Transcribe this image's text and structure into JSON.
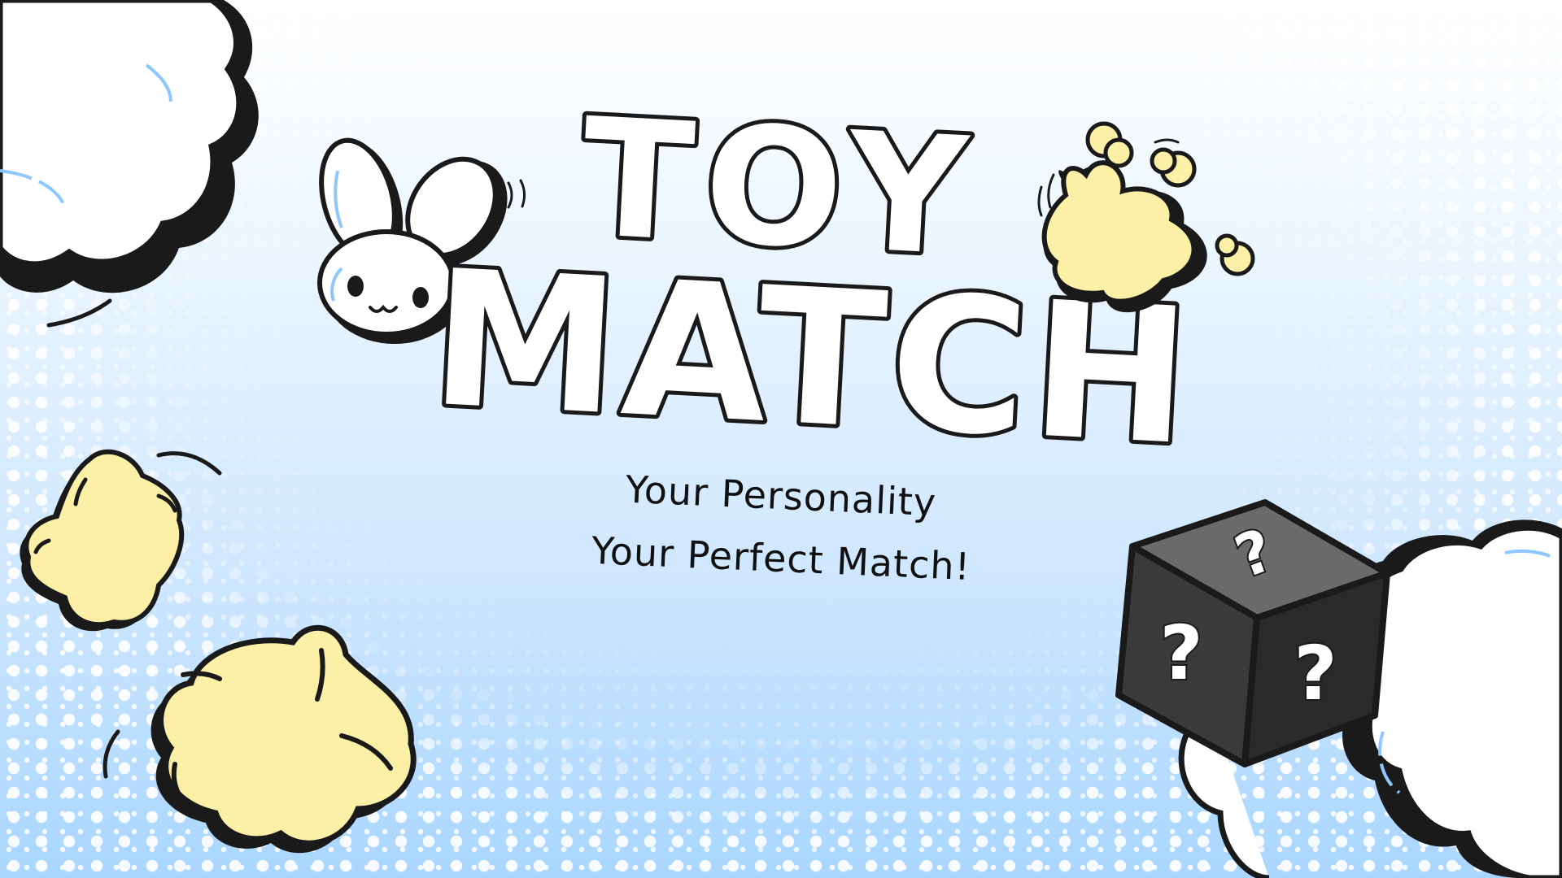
{
  "logo": {
    "line1": "TOY",
    "line2": "MATCH"
  },
  "tagline": {
    "line1": "Your Personality",
    "line2": "Your Perfect Match!"
  },
  "mystery_box_marks": [
    "?",
    "?",
    "?"
  ],
  "colors": {
    "background_top": "#ffffff",
    "background_bottom": "#a9d6ff",
    "outline": "#1a1a1a",
    "star_yellow": "#fbf0a6",
    "cloud_white": "#ffffff",
    "accent_blue": "#8cc8ff",
    "box_dark": "#3a3a3a"
  },
  "decorations": [
    "cloud-icon",
    "bunny-icon",
    "butterfly-icon",
    "star-icon",
    "mystery-box-icon"
  ]
}
